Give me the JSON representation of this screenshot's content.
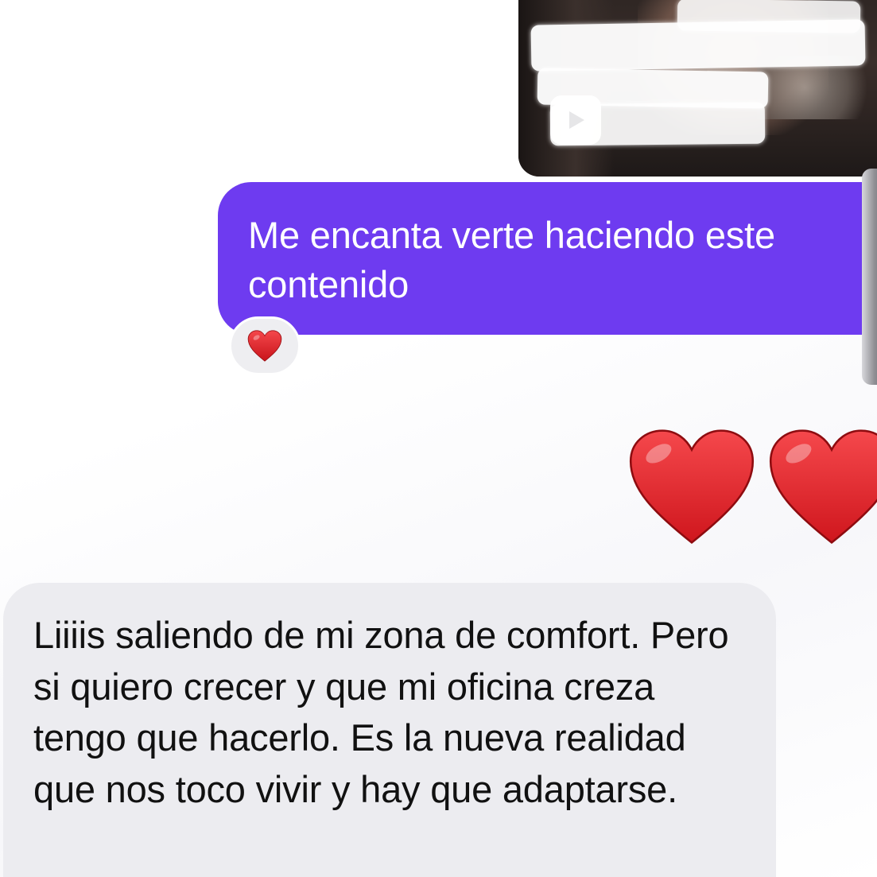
{
  "conversation": {
    "media_message": {
      "type": "video",
      "censored": true,
      "icon": "play-icon"
    },
    "outgoing_message": {
      "text": "Me encanta verte haciendo este contenido",
      "bubble_color": "#6e3bf0",
      "text_color": "#ffffff",
      "reaction": {
        "emoji": "❤️",
        "icon": "heart-icon"
      }
    },
    "heart_message": {
      "emoji": "❤️❤️",
      "count": 2,
      "icon": "heart-icon"
    },
    "incoming_message": {
      "text": "Liiiis saliendo de mi zona de comfort. Pero si quiero crecer y que mi oficina creza tengo que hacerlo. Es la nueva realidad que nos toco vivir y hay que adaptarse.",
      "bubble_color": "#ececf0",
      "text_color": "#111111"
    }
  },
  "colors": {
    "heart": "#e3262a",
    "outgoing_bubble": "#6e3bf0",
    "incoming_bubble": "#ececf0"
  }
}
